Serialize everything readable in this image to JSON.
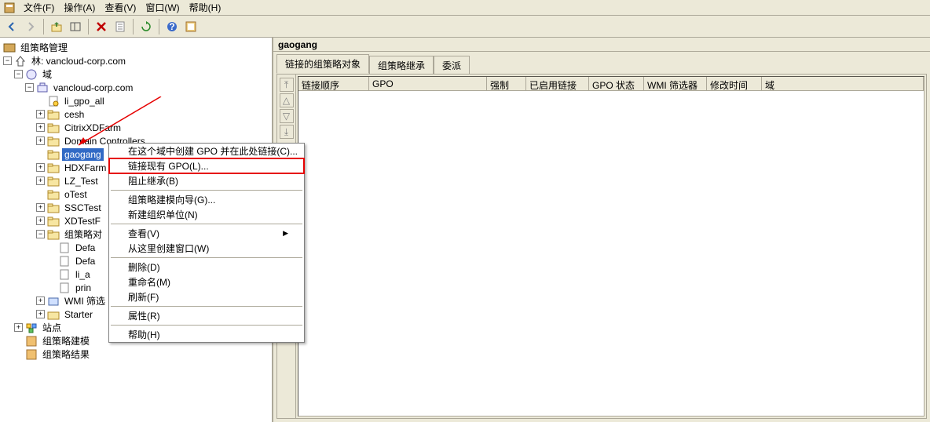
{
  "menu": {
    "file": "文件(F)",
    "action": "操作(A)",
    "view": "查看(V)",
    "window": "窗口(W)",
    "help": "帮助(H)"
  },
  "tree": {
    "root": "组策略管理",
    "forest_prefix": "林: ",
    "forest": "vancloud-corp.com",
    "domains": "域",
    "domain": "vancloud-corp.com",
    "li_gpo_all": "li_gpo_all",
    "cesh": "cesh",
    "citrix": "CitrixXDFarm",
    "dc": "Domain Controllers",
    "gaogang": "gaogang",
    "hdx": "HDXFarm",
    "lz": "LZ_Test",
    "otest": "oTest",
    "ssc": "SSCTest",
    "xdtest": "XDTestF",
    "gpos": "组策略对",
    "def1": "Defa",
    "def2": "Defa",
    "li_a": "li_a",
    "prin": "prin",
    "wmi": "WMI 筛选",
    "starter": "Starter",
    "sites": "站点",
    "modeling": "组策略建模",
    "results": "组策略结果"
  },
  "context": {
    "create": "在这个域中创建 GPO 并在此处链接(C)...",
    "link": "链接现有 GPO(L)...",
    "block": "阻止继承(B)",
    "wizard": "组策略建模向导(G)...",
    "newou": "新建组织单位(N)",
    "view": "查看(V)",
    "newwin": "从这里创建窗口(W)",
    "delete": "删除(D)",
    "rename": "重命名(M)",
    "refresh": "刷新(F)",
    "props": "属性(R)",
    "help": "帮助(H)"
  },
  "right": {
    "title": "gaogang",
    "tabs": {
      "linked": "链接的组策略对象",
      "inherit": "组策略继承",
      "deleg": "委派"
    },
    "cols": {
      "order": "链接顺序",
      "gpo": "GPO",
      "enforced": "强制",
      "linkEnabled": "已启用链接",
      "gpoStatus": "GPO 状态",
      "wmi": "WMI 筛选器",
      "modified": "修改时间",
      "domain": "域"
    }
  },
  "icons": {}
}
